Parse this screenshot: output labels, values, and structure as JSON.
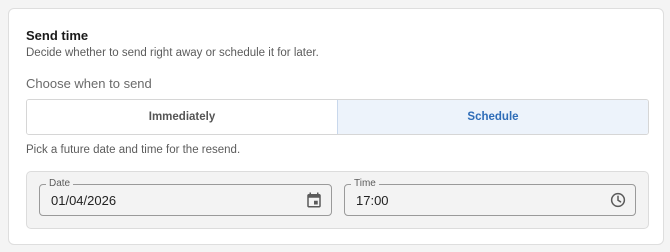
{
  "section": {
    "title": "Send time",
    "subtitle": "Decide whether to send right away or schedule it for later."
  },
  "choose": {
    "label": "Choose when to send",
    "options": [
      "Immediately",
      "Schedule"
    ],
    "selected": "Schedule"
  },
  "hint": "Pick a future date and time for the resend.",
  "date": {
    "label": "Date",
    "value": "01/04/2026",
    "icon": "calendar-icon"
  },
  "time": {
    "label": "Time",
    "value": "17:00",
    "icon": "clock-icon"
  },
  "colors": {
    "accent": "#2f6db8",
    "active_bg": "#edf3fb"
  }
}
